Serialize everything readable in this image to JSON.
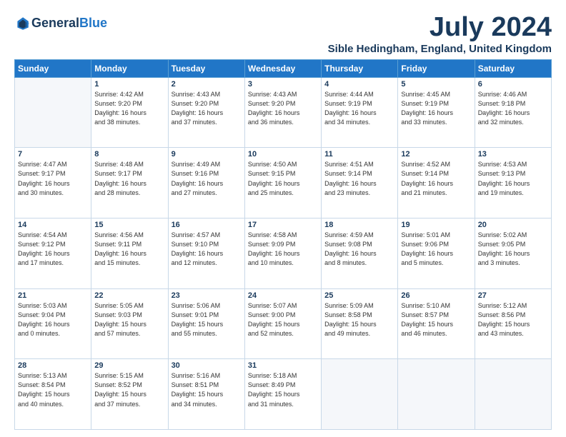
{
  "logo": {
    "line1": "General",
    "line2": "Blue"
  },
  "title": "July 2024",
  "subtitle": "Sible Hedingham, England, United Kingdom",
  "days_header": [
    "Sunday",
    "Monday",
    "Tuesday",
    "Wednesday",
    "Thursday",
    "Friday",
    "Saturday"
  ],
  "weeks": [
    [
      {
        "num": "",
        "info": ""
      },
      {
        "num": "1",
        "info": "Sunrise: 4:42 AM\nSunset: 9:20 PM\nDaylight: 16 hours\nand 38 minutes."
      },
      {
        "num": "2",
        "info": "Sunrise: 4:43 AM\nSunset: 9:20 PM\nDaylight: 16 hours\nand 37 minutes."
      },
      {
        "num": "3",
        "info": "Sunrise: 4:43 AM\nSunset: 9:20 PM\nDaylight: 16 hours\nand 36 minutes."
      },
      {
        "num": "4",
        "info": "Sunrise: 4:44 AM\nSunset: 9:19 PM\nDaylight: 16 hours\nand 34 minutes."
      },
      {
        "num": "5",
        "info": "Sunrise: 4:45 AM\nSunset: 9:19 PM\nDaylight: 16 hours\nand 33 minutes."
      },
      {
        "num": "6",
        "info": "Sunrise: 4:46 AM\nSunset: 9:18 PM\nDaylight: 16 hours\nand 32 minutes."
      }
    ],
    [
      {
        "num": "7",
        "info": "Sunrise: 4:47 AM\nSunset: 9:17 PM\nDaylight: 16 hours\nand 30 minutes."
      },
      {
        "num": "8",
        "info": "Sunrise: 4:48 AM\nSunset: 9:17 PM\nDaylight: 16 hours\nand 28 minutes."
      },
      {
        "num": "9",
        "info": "Sunrise: 4:49 AM\nSunset: 9:16 PM\nDaylight: 16 hours\nand 27 minutes."
      },
      {
        "num": "10",
        "info": "Sunrise: 4:50 AM\nSunset: 9:15 PM\nDaylight: 16 hours\nand 25 minutes."
      },
      {
        "num": "11",
        "info": "Sunrise: 4:51 AM\nSunset: 9:14 PM\nDaylight: 16 hours\nand 23 minutes."
      },
      {
        "num": "12",
        "info": "Sunrise: 4:52 AM\nSunset: 9:14 PM\nDaylight: 16 hours\nand 21 minutes."
      },
      {
        "num": "13",
        "info": "Sunrise: 4:53 AM\nSunset: 9:13 PM\nDaylight: 16 hours\nand 19 minutes."
      }
    ],
    [
      {
        "num": "14",
        "info": "Sunrise: 4:54 AM\nSunset: 9:12 PM\nDaylight: 16 hours\nand 17 minutes."
      },
      {
        "num": "15",
        "info": "Sunrise: 4:56 AM\nSunset: 9:11 PM\nDaylight: 16 hours\nand 15 minutes."
      },
      {
        "num": "16",
        "info": "Sunrise: 4:57 AM\nSunset: 9:10 PM\nDaylight: 16 hours\nand 12 minutes."
      },
      {
        "num": "17",
        "info": "Sunrise: 4:58 AM\nSunset: 9:09 PM\nDaylight: 16 hours\nand 10 minutes."
      },
      {
        "num": "18",
        "info": "Sunrise: 4:59 AM\nSunset: 9:08 PM\nDaylight: 16 hours\nand 8 minutes."
      },
      {
        "num": "19",
        "info": "Sunrise: 5:01 AM\nSunset: 9:06 PM\nDaylight: 16 hours\nand 5 minutes."
      },
      {
        "num": "20",
        "info": "Sunrise: 5:02 AM\nSunset: 9:05 PM\nDaylight: 16 hours\nand 3 minutes."
      }
    ],
    [
      {
        "num": "21",
        "info": "Sunrise: 5:03 AM\nSunset: 9:04 PM\nDaylight: 16 hours\nand 0 minutes."
      },
      {
        "num": "22",
        "info": "Sunrise: 5:05 AM\nSunset: 9:03 PM\nDaylight: 15 hours\nand 57 minutes."
      },
      {
        "num": "23",
        "info": "Sunrise: 5:06 AM\nSunset: 9:01 PM\nDaylight: 15 hours\nand 55 minutes."
      },
      {
        "num": "24",
        "info": "Sunrise: 5:07 AM\nSunset: 9:00 PM\nDaylight: 15 hours\nand 52 minutes."
      },
      {
        "num": "25",
        "info": "Sunrise: 5:09 AM\nSunset: 8:58 PM\nDaylight: 15 hours\nand 49 minutes."
      },
      {
        "num": "26",
        "info": "Sunrise: 5:10 AM\nSunset: 8:57 PM\nDaylight: 15 hours\nand 46 minutes."
      },
      {
        "num": "27",
        "info": "Sunrise: 5:12 AM\nSunset: 8:56 PM\nDaylight: 15 hours\nand 43 minutes."
      }
    ],
    [
      {
        "num": "28",
        "info": "Sunrise: 5:13 AM\nSunset: 8:54 PM\nDaylight: 15 hours\nand 40 minutes."
      },
      {
        "num": "29",
        "info": "Sunrise: 5:15 AM\nSunset: 8:52 PM\nDaylight: 15 hours\nand 37 minutes."
      },
      {
        "num": "30",
        "info": "Sunrise: 5:16 AM\nSunset: 8:51 PM\nDaylight: 15 hours\nand 34 minutes."
      },
      {
        "num": "31",
        "info": "Sunrise: 5:18 AM\nSunset: 8:49 PM\nDaylight: 15 hours\nand 31 minutes."
      },
      {
        "num": "",
        "info": ""
      },
      {
        "num": "",
        "info": ""
      },
      {
        "num": "",
        "info": ""
      }
    ]
  ]
}
